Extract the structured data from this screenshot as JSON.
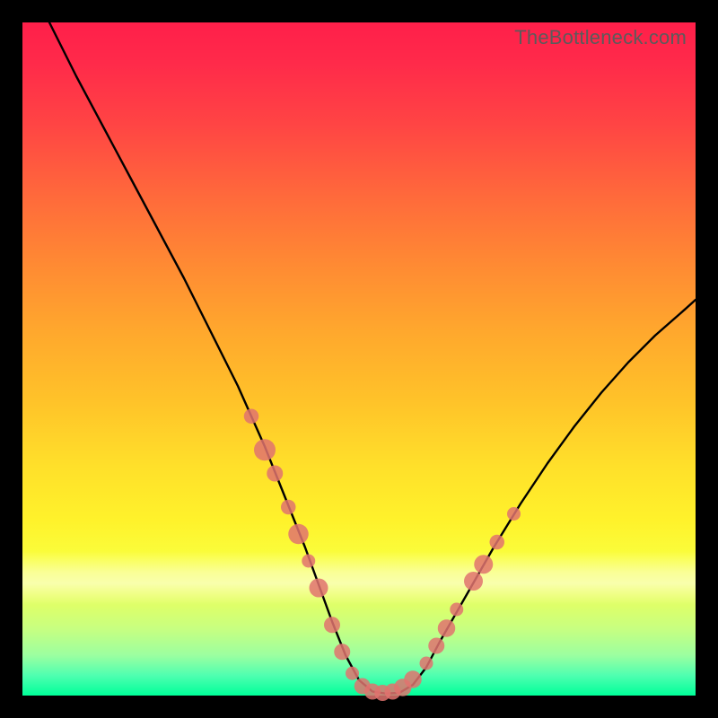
{
  "watermark": "TheBottleneck.com",
  "chart_data": {
    "type": "line",
    "title": "",
    "xlabel": "",
    "ylabel": "",
    "xlim": [
      0,
      100
    ],
    "ylim": [
      0,
      100
    ],
    "grid": false,
    "legend": false,
    "series": [
      {
        "name": "curve",
        "color": "#000000",
        "x": [
          4,
          8,
          12,
          16,
          20,
          24,
          28,
          30,
          32,
          34,
          36,
          38,
          40,
          42,
          44,
          46,
          48,
          50,
          52,
          54,
          56,
          58,
          60,
          62,
          66,
          70,
          74,
          78,
          82,
          86,
          90,
          94,
          98,
          100
        ],
        "y": [
          100,
          92,
          84.5,
          77,
          69.5,
          62,
          54,
          50,
          46,
          41.5,
          37,
          32,
          27,
          22,
          16.5,
          11,
          6,
          2.3,
          0.6,
          0.3,
          0.4,
          1.6,
          4.2,
          8,
          15,
          22,
          28.5,
          34.5,
          40,
          45,
          49.5,
          53.5,
          57,
          58.8
        ]
      }
    ],
    "markers": [
      {
        "name": "dots",
        "color": "#e0736f",
        "points": [
          {
            "x": 34.0,
            "y": 41.5,
            "r": 1.1
          },
          {
            "x": 36.0,
            "y": 36.5,
            "r": 1.6
          },
          {
            "x": 37.5,
            "y": 33.0,
            "r": 1.2
          },
          {
            "x": 39.5,
            "y": 28.0,
            "r": 1.1
          },
          {
            "x": 41.0,
            "y": 24.0,
            "r": 1.5
          },
          {
            "x": 42.5,
            "y": 20.0,
            "r": 1.0
          },
          {
            "x": 44.0,
            "y": 16.0,
            "r": 1.4
          },
          {
            "x": 46.0,
            "y": 10.5,
            "r": 1.2
          },
          {
            "x": 47.5,
            "y": 6.5,
            "r": 1.2
          },
          {
            "x": 49.0,
            "y": 3.3,
            "r": 1.0
          },
          {
            "x": 50.5,
            "y": 1.4,
            "r": 1.2
          },
          {
            "x": 52.0,
            "y": 0.6,
            "r": 1.2
          },
          {
            "x": 53.5,
            "y": 0.4,
            "r": 1.2
          },
          {
            "x": 55.0,
            "y": 0.6,
            "r": 1.2
          },
          {
            "x": 56.5,
            "y": 1.2,
            "r": 1.3
          },
          {
            "x": 58.0,
            "y": 2.4,
            "r": 1.3
          },
          {
            "x": 60.0,
            "y": 4.8,
            "r": 1.0
          },
          {
            "x": 61.5,
            "y": 7.4,
            "r": 1.2
          },
          {
            "x": 63.0,
            "y": 10.0,
            "r": 1.3
          },
          {
            "x": 64.5,
            "y": 12.8,
            "r": 1.0
          },
          {
            "x": 67.0,
            "y": 17.0,
            "r": 1.4
          },
          {
            "x": 68.5,
            "y": 19.5,
            "r": 1.4
          },
          {
            "x": 70.5,
            "y": 22.8,
            "r": 1.1
          },
          {
            "x": 73.0,
            "y": 27.0,
            "r": 1.0
          }
        ]
      }
    ]
  }
}
